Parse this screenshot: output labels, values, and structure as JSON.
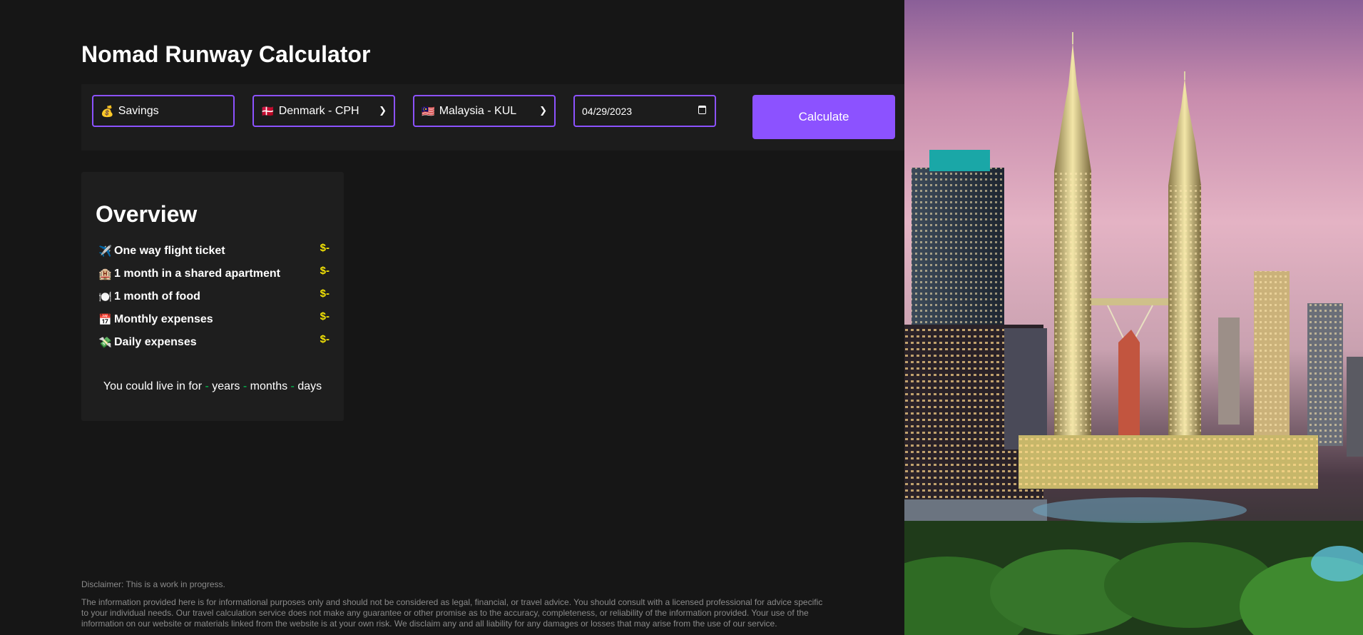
{
  "app": {
    "title": "Nomad Runway Calculator"
  },
  "controls": {
    "savings": {
      "icon": "money-bag",
      "placeholder": "Savings"
    },
    "origin": {
      "flag": "🇩🇰",
      "value": "Denmark - CPH"
    },
    "destination": {
      "flag": "🇲🇾",
      "value": "Malaysia - KUL"
    },
    "date": {
      "value": "04/29/2023"
    },
    "calculate_label": "Calculate"
  },
  "overview": {
    "title": "Overview",
    "rows": [
      {
        "icon": "airplane",
        "glyph": "✈️",
        "label": "One way flight ticket",
        "value": "$-"
      },
      {
        "icon": "hotel",
        "glyph": "🏨",
        "label": "1 month in a shared apartment",
        "value": "$-"
      },
      {
        "icon": "plate",
        "glyph": "🍽️",
        "label": "1 month of food",
        "value": "$-"
      },
      {
        "icon": "calendar",
        "glyph": "📅",
        "label": "Monthly expenses",
        "value": "$-"
      },
      {
        "icon": "flying-money",
        "glyph": "💸",
        "label": "Daily expenses",
        "value": "$-"
      }
    ],
    "summary": {
      "prefix": "You could live in for",
      "years_value": "-",
      "years_label": "years",
      "months_value": "-",
      "months_label": "months",
      "days_value": "-",
      "days_label": "days"
    }
  },
  "disclaimer": {
    "short": "Disclaimer: This is a work in progress.",
    "long": "The information provided here is for informational purposes only and should not be considered as legal, financial, or travel advice. You should consult with a licensed professional for advice specific to your individual needs. Our travel calculation service does not make any guarantee or other promise as to the accuracy, completeness, or reliability of the information provided. Your use of the information on our website or materials linked from the website is at your own risk. We disclaim any and all liability for any damages or losses that may arise from the use of our service."
  },
  "colors": {
    "accent": "#8c52ff",
    "value_yellow": "#f2e205",
    "dash_green": "#00c853",
    "background": "#161616"
  }
}
